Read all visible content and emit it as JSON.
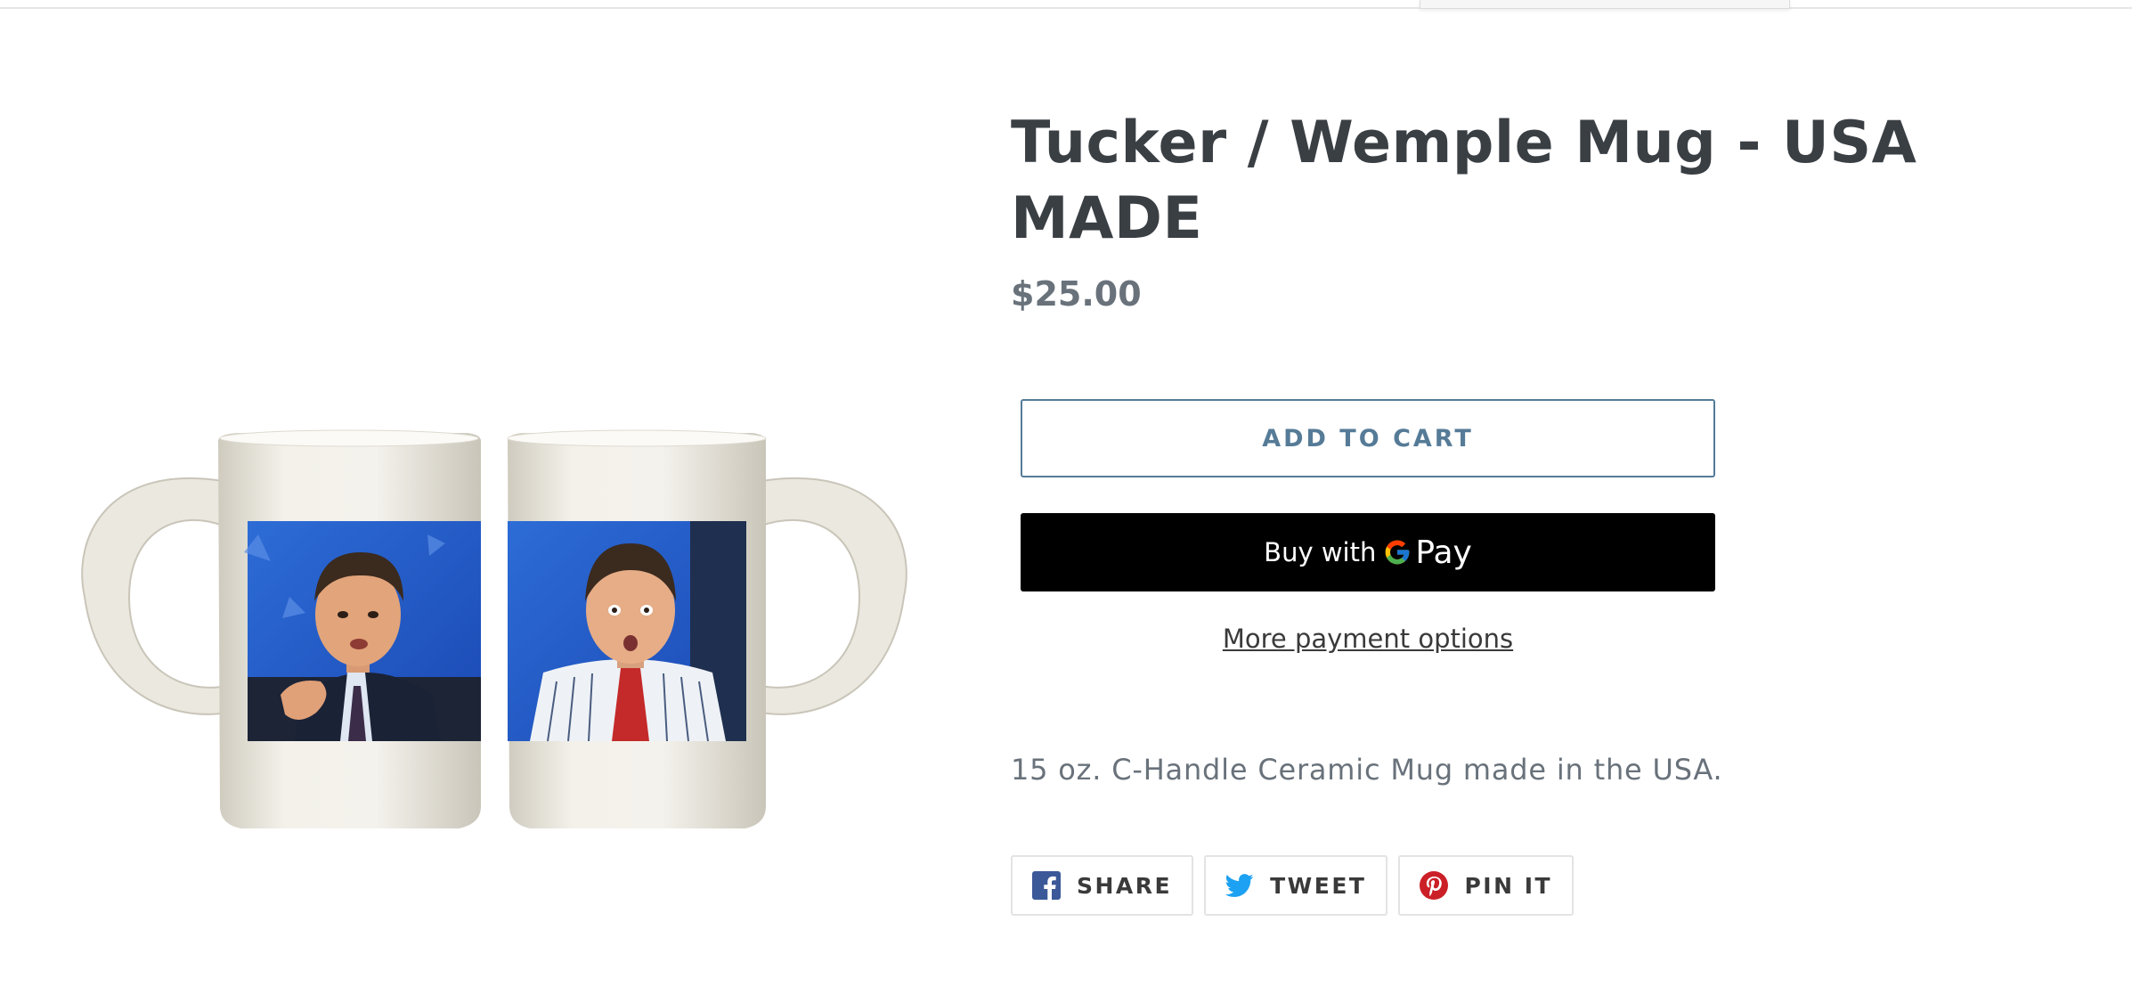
{
  "product": {
    "title": "Tucker / Wemple Mug - USA MADE",
    "price": "$25.00",
    "add_to_cart_label": "ADD TO CART",
    "gpay": {
      "buy_label": "Buy with",
      "pay_label": "Pay"
    },
    "more_payment_label": "More payment options",
    "description": "15 oz. C-Handle Ceramic Mug made in the USA.",
    "image_alt": "Two white ceramic mugs printed with TV news screenshots"
  },
  "share": {
    "facebook": {
      "label": "SHARE",
      "icon": "facebook-icon",
      "color": "#3b5998"
    },
    "twitter": {
      "label": "TWEET",
      "icon": "twitter-icon",
      "color": "#1da1f2"
    },
    "pinterest": {
      "label": "PIN IT",
      "icon": "pinterest-icon",
      "color": "#cb2027"
    }
  },
  "colors": {
    "accent": "#557b97",
    "title": "#3a3f44",
    "muted": "#69727b"
  }
}
